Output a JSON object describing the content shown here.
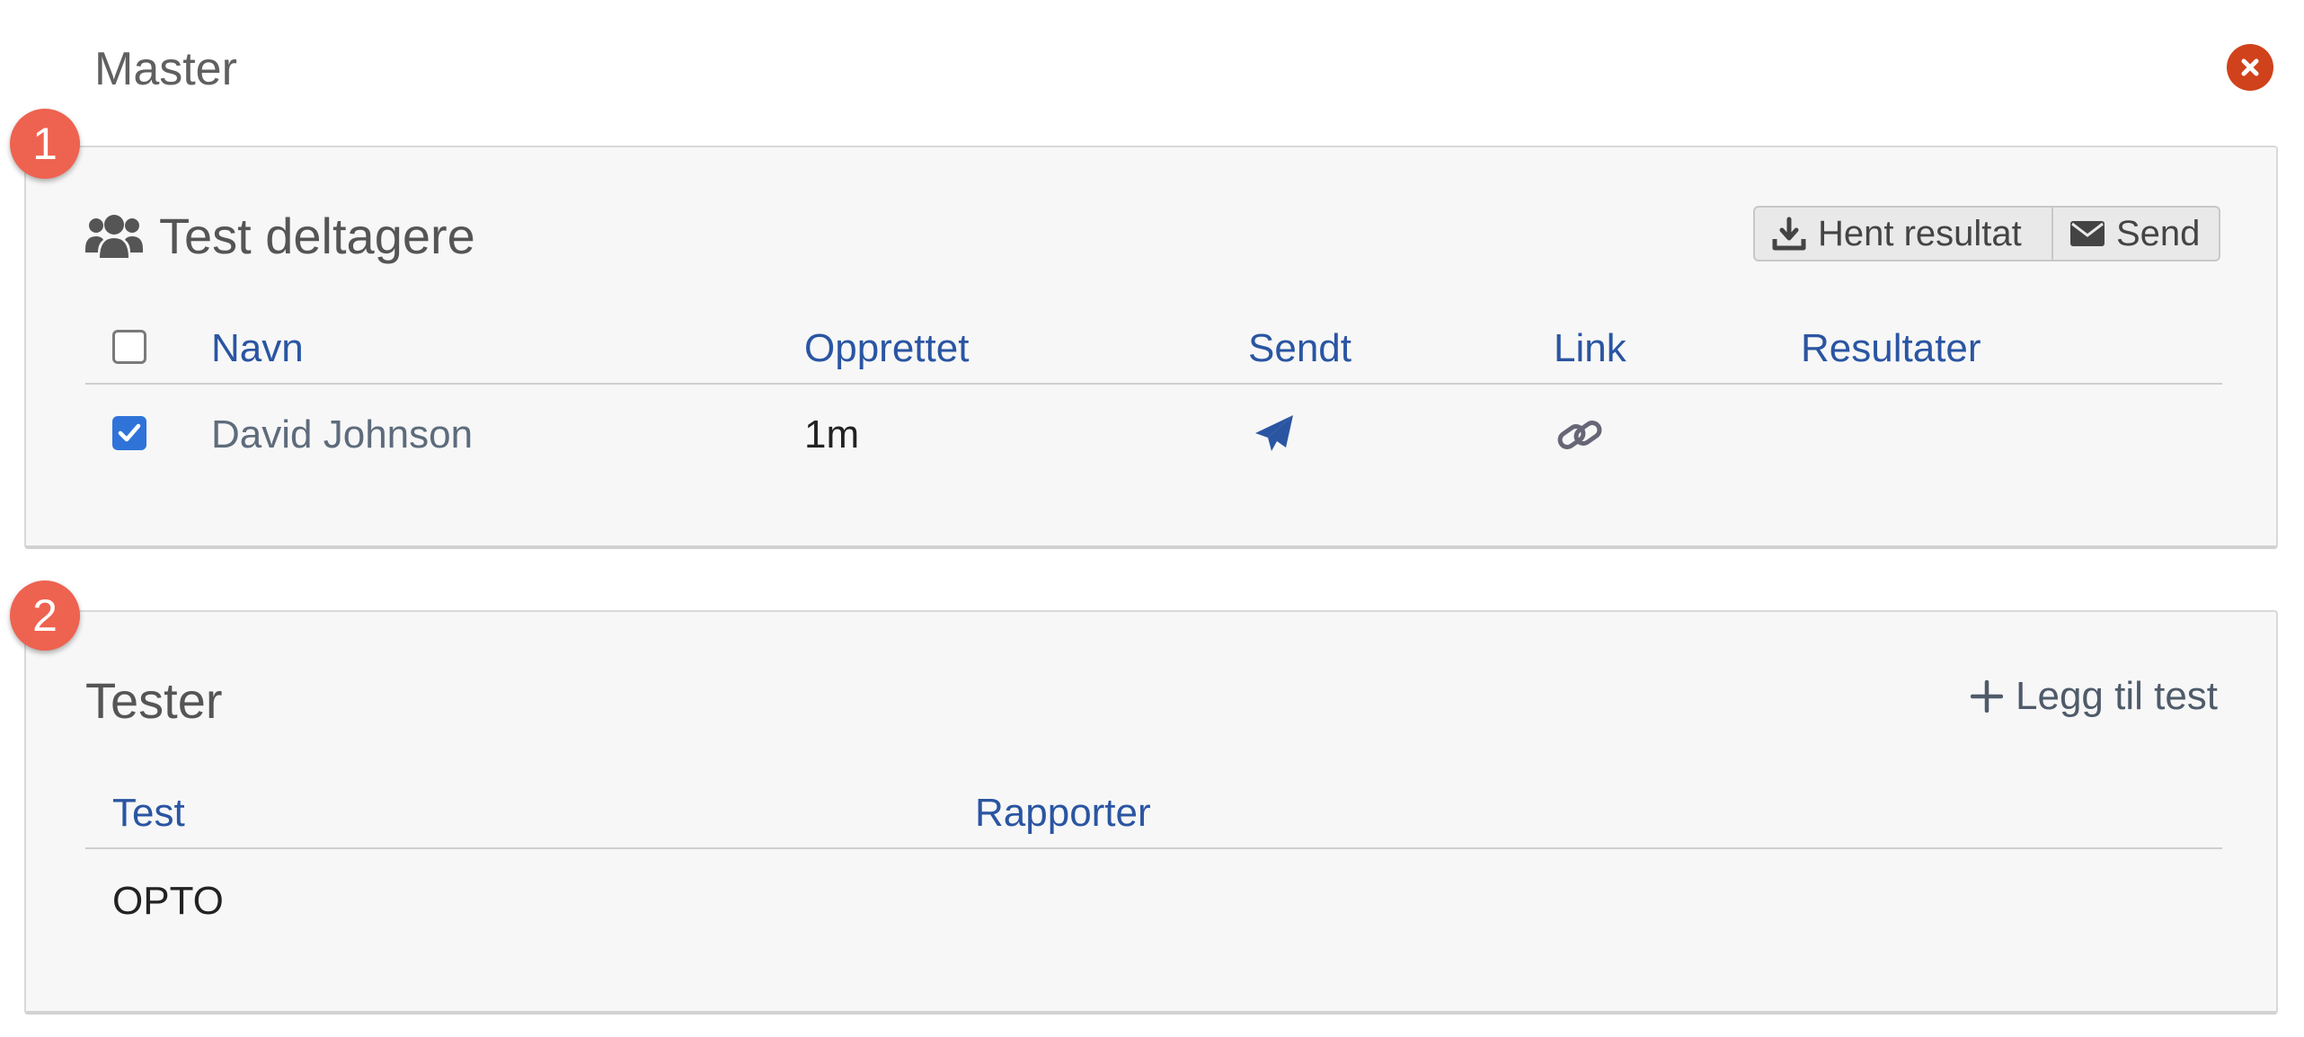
{
  "header": {
    "title": "Master",
    "close_icon": "close-icon"
  },
  "badges": {
    "first": "1",
    "second": "2"
  },
  "participants": {
    "title": "Test deltagere",
    "icon": "users-icon",
    "buttons": {
      "fetch_results": "Hent resultat",
      "send": "Send"
    },
    "columns": [
      "Navn",
      "Opprettet",
      "Sendt",
      "Link",
      "Resultater"
    ],
    "rows": [
      {
        "name": "David Johnson",
        "created": "1m",
        "sent_icon": "paper-plane-icon",
        "link_icon": "link-icon",
        "results": "",
        "checked": true
      }
    ]
  },
  "tests": {
    "title": "Tester",
    "add_label": "Legg til test",
    "columns": [
      "Test",
      "Rapporter"
    ],
    "rows": [
      {
        "test": "OPTO",
        "reports": ""
      }
    ]
  },
  "colors": {
    "accent": "#2a55a2",
    "badge": "#ee6250",
    "close": "#d0421b",
    "checkbox": "#2f73d9"
  }
}
